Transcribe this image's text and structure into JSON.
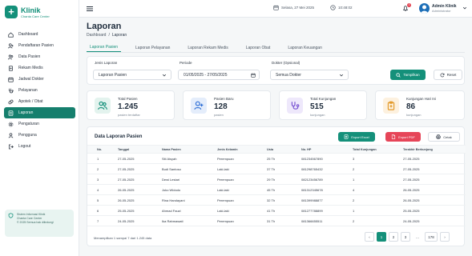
{
  "brand": {
    "name": "Klinik",
    "subtitle": "Chanta Care Center"
  },
  "sidebar": {
    "items": [
      {
        "label": "Dashboard",
        "icon": "dashboard-icon",
        "active": false
      },
      {
        "label": "Pendaftaran Pasien",
        "icon": "user-plus-icon",
        "active": false
      },
      {
        "label": "Data Pasien",
        "icon": "users-icon",
        "active": false
      },
      {
        "label": "Rekam Medis",
        "icon": "file-medical-icon",
        "active": false
      },
      {
        "label": "Jadwal Dokter",
        "icon": "calendar-icon",
        "active": false
      },
      {
        "label": "Pelayanan",
        "icon": "stethoscope-icon",
        "active": false
      },
      {
        "label": "Apotek / Obat",
        "icon": "pill-icon",
        "active": false
      },
      {
        "label": "Laporan",
        "icon": "report-icon",
        "active": true
      },
      {
        "label": "Pengaturan",
        "icon": "gear-icon",
        "active": false
      },
      {
        "label": "Pengguna",
        "icon": "user-icon",
        "active": false
      },
      {
        "label": "Logout",
        "icon": "logout-icon",
        "active": false
      }
    ],
    "footer_line1": "Sistem Informasi Klinik",
    "footer_line2": "Chanta Care Center",
    "footer_line3": "© 2025 Semua hak dilindungi"
  },
  "topbar": {
    "date": "Selasa, 27 Mei 2025",
    "time": "10:48:02",
    "notif_count": "3",
    "user_name": "Admin Klinik",
    "user_role": "Administrator"
  },
  "page": {
    "title": "Laporan",
    "breadcrumb": {
      "root": "Dashboard",
      "sep": "/",
      "current": "Laporan"
    }
  },
  "tabs": [
    {
      "label": "Laporan Pasien",
      "active": true
    },
    {
      "label": "Laporan Pelayanan",
      "active": false
    },
    {
      "label": "Laporan Rekam Medis",
      "active": false
    },
    {
      "label": "Laporan Obat",
      "active": false
    },
    {
      "label": "Laporan Keuangan",
      "active": false
    }
  ],
  "filters": {
    "jenis_label": "Jenis Laporan",
    "jenis_value": "Laporan Pasien",
    "periode_label": "Periode",
    "periode_value": "01/05/2025 - 27/05/2025",
    "dokter_label": "Dokter (Opsional)",
    "dokter_value": "Semua Dokter",
    "show_label": "Tampilkan",
    "reset_label": "Reset"
  },
  "stats": [
    {
      "label": "Total Pasien",
      "value": "1.245",
      "sub": "pasien terdaftar",
      "icon": "users-icon",
      "bg": "#e3f3ee",
      "fg": "#14907a"
    },
    {
      "label": "Pasien Baru",
      "value": "128",
      "sub": "pasien",
      "icon": "user-plus-icon",
      "bg": "#e4edfb",
      "fg": "#2f6fd6"
    },
    {
      "label": "Total Kunjungan",
      "value": "515",
      "sub": "kunjungan",
      "icon": "stethoscope-icon",
      "bg": "#eee8fb",
      "fg": "#7a55d3"
    },
    {
      "label": "Kunjungan Hari Ini",
      "value": "86",
      "sub": "kunjungan",
      "icon": "clipboard-icon",
      "bg": "#fdf1df",
      "fg": "#e39b2d"
    }
  ],
  "colors": {
    "accent": "#14907a",
    "danger": "#e64558",
    "active_nav": "#157f6d"
  },
  "table": {
    "title": "Data Laporan Pasien",
    "export_excel": "Export Excel",
    "export_pdf": "Export PDF",
    "print": "Cetak",
    "headers": [
      "No.",
      "Tanggal",
      "Nama Pasien",
      "Jenis Kelamin",
      "Usia",
      "No. HP",
      "Total Kunjungan",
      "Terakhir Berkunjung"
    ],
    "rows": [
      [
        "1",
        "27-05-2025",
        "Siti Aisyah",
        "Perempuan",
        "25 Th",
        "081234567890",
        "3",
        "27-05-2025"
      ],
      [
        "2",
        "27-05-2025",
        "Budi Santoso",
        "Laki-laki",
        "37 Th",
        "081298765432",
        "2",
        "27-05-2025"
      ],
      [
        "3",
        "27-05-2025",
        "Dewi Lestari",
        "Perempuan",
        "29 Th",
        "082123456789",
        "1",
        "27-05-2025"
      ],
      [
        "4",
        "26-05-2025",
        "Joko Widodo",
        "Laki-laki",
        "45 Th",
        "081312345678",
        "4",
        "26-05-2025"
      ],
      [
        "5",
        "26-05-2025",
        "Rina Handayani",
        "Perempuan",
        "32 Th",
        "081399988877",
        "2",
        "26-05-2025"
      ],
      [
        "6",
        "25-05-2025",
        "Ahmad Fauzi",
        "Laki-laki",
        "41 Th",
        "081277788899",
        "1",
        "25-05-2025"
      ],
      [
        "7",
        "24-05-2025",
        "Ika Rahmawati",
        "Perempuan",
        "31 Th",
        "081366655511",
        "2",
        "24-05-2025"
      ]
    ],
    "footer": "Menampilkan 1 sampai 7 dari 1.245 data",
    "pages": [
      "‹",
      "1",
      "2",
      "3",
      "...",
      "178",
      "›"
    ],
    "active_page": "1"
  }
}
